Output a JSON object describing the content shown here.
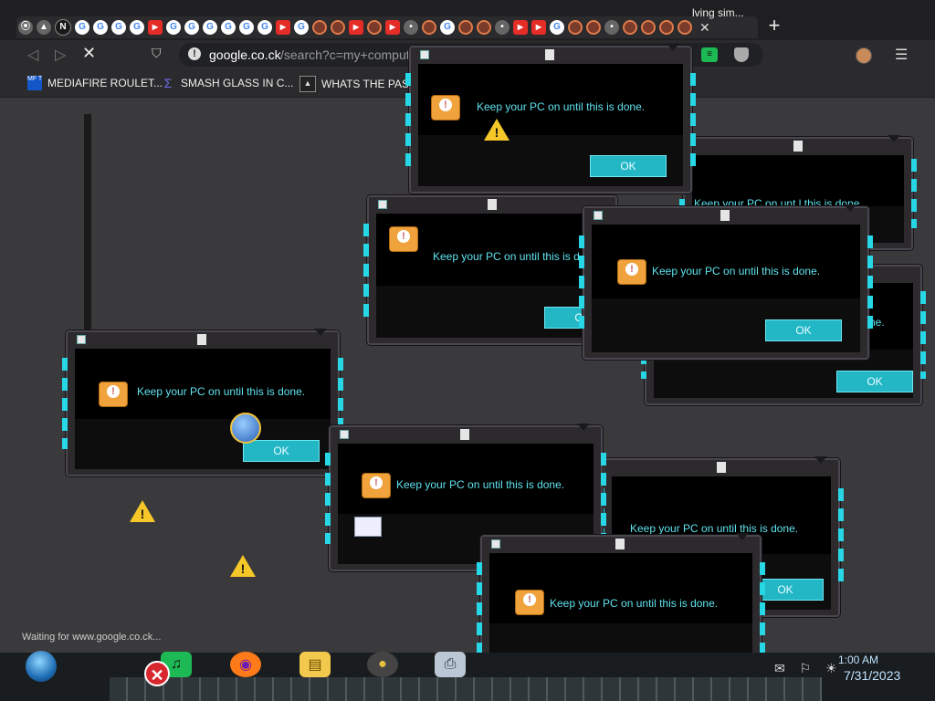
{
  "browser": {
    "tabs": [
      {
        "icon": "chrome-icon",
        "glyph": "⦿",
        "kind": "gr"
      },
      {
        "icon": "google-drive-icon",
        "glyph": "▲",
        "kind": "gr"
      },
      {
        "icon": "generic-tab-icon",
        "glyph": "N",
        "kind": "dr"
      },
      {
        "icon": "google-icon",
        "glyph": "G",
        "kind": "g"
      },
      {
        "icon": "google-icon",
        "glyph": "G",
        "kind": "g"
      },
      {
        "icon": "google-icon",
        "glyph": "G",
        "kind": "g"
      },
      {
        "icon": "google-icon",
        "glyph": "G",
        "kind": "g"
      },
      {
        "icon": "youtube-icon",
        "glyph": "▶",
        "kind": "yt"
      },
      {
        "icon": "google-icon",
        "glyph": "G",
        "kind": "g"
      },
      {
        "icon": "google-icon",
        "glyph": "G",
        "kind": "g"
      },
      {
        "icon": "google-icon",
        "glyph": "G",
        "kind": "g"
      },
      {
        "icon": "google-icon",
        "glyph": "G",
        "kind": "g"
      },
      {
        "icon": "google-icon",
        "glyph": "G",
        "kind": "g"
      },
      {
        "icon": "google-icon",
        "glyph": "G",
        "kind": "g"
      },
      {
        "icon": "youtube-icon",
        "glyph": "▶",
        "kind": "yt"
      },
      {
        "icon": "google-icon",
        "glyph": "G",
        "kind": "g"
      },
      {
        "icon": "swirl-icon",
        "glyph": "",
        "kind": "sp"
      },
      {
        "icon": "swirl-icon",
        "glyph": "",
        "kind": "sp"
      },
      {
        "icon": "youtube-icon",
        "glyph": "▶",
        "kind": "yt"
      },
      {
        "icon": "swirl-icon",
        "glyph": "",
        "kind": "sp"
      },
      {
        "icon": "youtube-icon",
        "glyph": "▶",
        "kind": "yt"
      },
      {
        "icon": "generic-tab-icon",
        "glyph": "•",
        "kind": "gr"
      },
      {
        "icon": "swirl-icon",
        "glyph": "",
        "kind": "sp"
      },
      {
        "icon": "google-icon",
        "glyph": "G",
        "kind": "g"
      },
      {
        "icon": "swirl-icon",
        "glyph": "",
        "kind": "sp"
      },
      {
        "icon": "swirl-icon",
        "glyph": "",
        "kind": "sp"
      },
      {
        "icon": "generic-tab-icon",
        "glyph": "•",
        "kind": "gr"
      },
      {
        "icon": "youtube-icon",
        "glyph": "▶",
        "kind": "yt"
      },
      {
        "icon": "youtube-icon",
        "glyph": "▶",
        "kind": "yt"
      },
      {
        "icon": "google-icon",
        "glyph": "G",
        "kind": "g"
      },
      {
        "icon": "swirl-icon",
        "glyph": "",
        "kind": "sp"
      },
      {
        "icon": "swirl-icon",
        "glyph": "",
        "kind": "sp"
      },
      {
        "icon": "generic-tab-icon",
        "glyph": "•",
        "kind": "gr"
      },
      {
        "icon": "swirl-icon",
        "glyph": "",
        "kind": "sp"
      },
      {
        "icon": "swirl-icon",
        "glyph": "",
        "kind": "sp"
      },
      {
        "icon": "swirl-icon",
        "glyph": "",
        "kind": "sp"
      },
      {
        "icon": "swirl-icon",
        "glyph": "",
        "kind": "sp"
      }
    ],
    "tab_close": "✕",
    "new_tab": "+",
    "back": "◁",
    "forward": "▷",
    "stop": "✕",
    "bookmark_glyph": "⛉",
    "info_glyph": "!",
    "url_host": "google.co.ck",
    "url_path": "/search?c=my+comput",
    "ext_glyph": "≡",
    "menu_glyph": "☰"
  },
  "bookmarks": [
    {
      "label": "MEDIAFIRE ROULET...",
      "icon": "mediafire-icon",
      "badge": "MF T"
    },
    {
      "label": "SMASH GLASS IN C...",
      "icon": "smash-glass-icon",
      "badge": "Σ"
    },
    {
      "label": "WHATS THE PAS...",
      "icon": "site-icon",
      "badge": "▲"
    }
  ],
  "bookmark_partial": "lving sim...",
  "status_text": "Waiting for www.google.co.ck...",
  "dialogs": [
    {
      "message": "Keep your PC on until this is done.",
      "ok": "OK"
    },
    {
      "message": "Keep your PC on unt l this is done.",
      "ok": "OK"
    },
    {
      "message": "Keep your PC on until this is d",
      "ok": "OK"
    },
    {
      "message": "Keep your PC on until this is done.",
      "ok": "OK"
    },
    {
      "message": "Keep your PC on until this is done.",
      "ok": "OK"
    },
    {
      "message": "Keep your PC on until this is done.",
      "ok": "OK"
    },
    {
      "message": "Keep your PC on until this is done.",
      "ok": "OK"
    },
    {
      "message": "Keep your PC on until this is done.",
      "ok": "OK"
    },
    {
      "message": "ne.",
      "ok": "OK"
    }
  ],
  "taskbar": {
    "date": "7/31/2023",
    "time": "1:00 AM",
    "error_glyph": "✕",
    "tray_glyphs": "✉ ⚐ ☀"
  }
}
